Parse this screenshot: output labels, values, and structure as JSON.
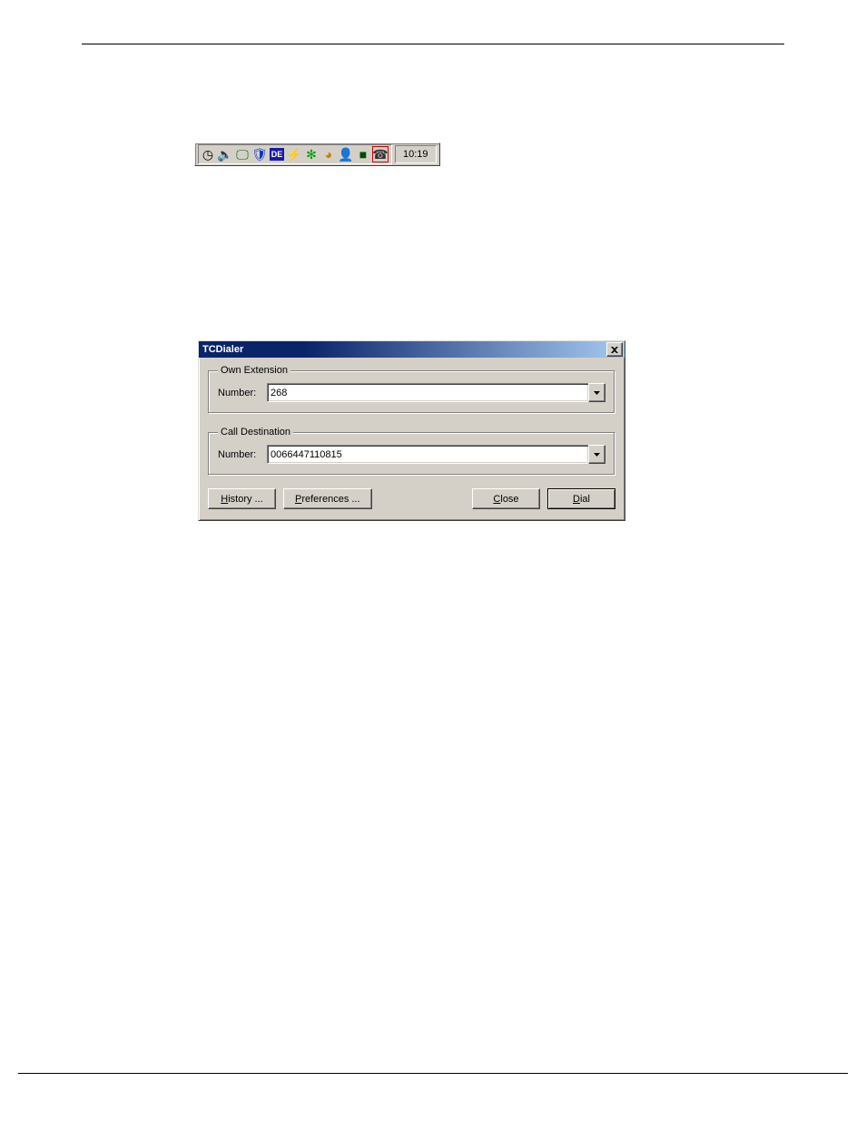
{
  "tray": {
    "clock": "10:19",
    "de_label": "DE",
    "icons": [
      {
        "name": "clock-icon",
        "glyph": "◔"
      },
      {
        "name": "volume-icon",
        "glyph": "🔊"
      },
      {
        "name": "monitor-icon",
        "glyph": "🖥"
      },
      {
        "name": "shield-icon",
        "glyph": "🛡"
      },
      {
        "name": "lang-de-icon",
        "glyph": "DE"
      },
      {
        "name": "lightning-icon",
        "glyph": "⚡"
      },
      {
        "name": "icq-flower-icon",
        "glyph": "❋"
      },
      {
        "name": "drop-icon",
        "glyph": "🔵"
      },
      {
        "name": "network-icon",
        "glyph": "👥"
      },
      {
        "name": "square-icon",
        "glyph": "■"
      },
      {
        "name": "phone-icon",
        "glyph": "☎"
      }
    ]
  },
  "dialog": {
    "title": "TCDialer",
    "groups": {
      "own_extension": {
        "legend": "Own Extension",
        "label": "Number:",
        "value": "268"
      },
      "call_destination": {
        "legend": "Call Destination",
        "label": "Number:",
        "value": "0066447110815"
      }
    },
    "buttons": {
      "history": "History ...",
      "preferences": "Preferences ...",
      "close": "Close",
      "dial": "Dial"
    }
  }
}
